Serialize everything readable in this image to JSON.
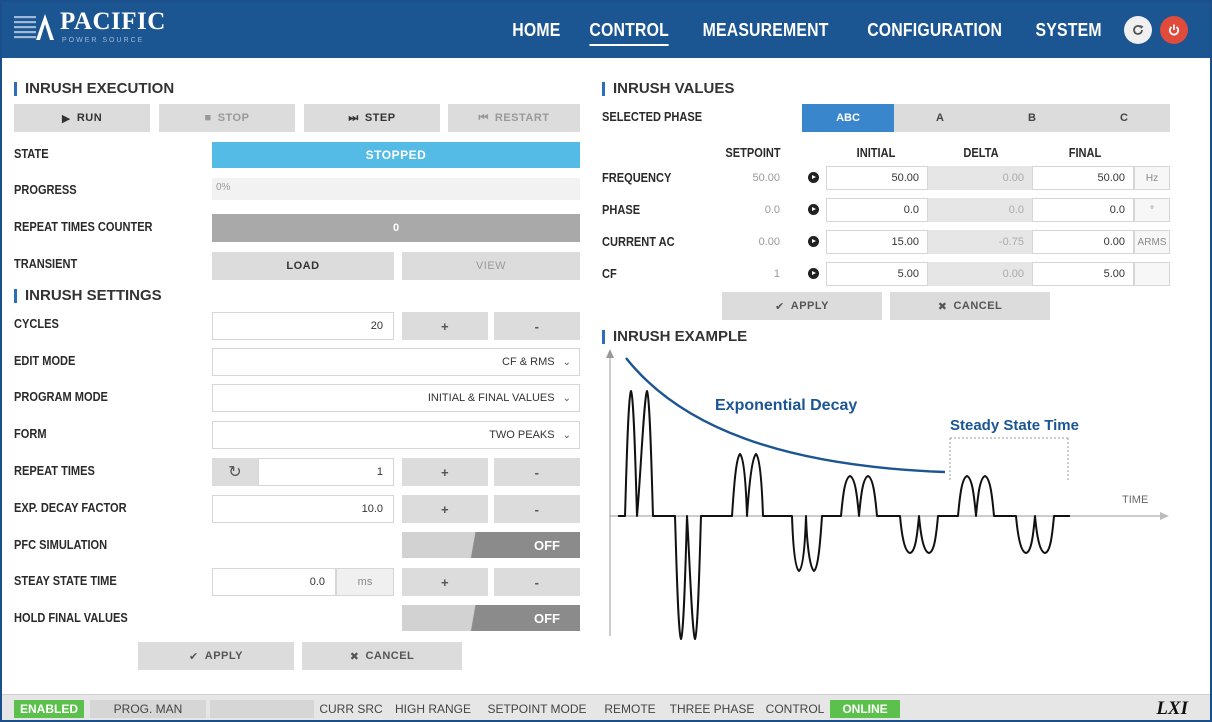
{
  "header": {
    "brand": "PACIFIC",
    "brand_sub": "POWER SOURCE",
    "nav": [
      "HOME",
      "CONTROL",
      "MEASUREMENT",
      "CONFIGURATION",
      "SYSTEM"
    ],
    "active_nav": "CONTROL"
  },
  "execution": {
    "title": "INRUSH EXECUTION",
    "run": "RUN",
    "stop": "STOP",
    "step": "STEP",
    "restart": "RESTART",
    "state_label": "STATE",
    "state_value": "STOPPED",
    "progress_label": "PROGRESS",
    "progress_value": "0%",
    "progress_fraction": 0,
    "repeat_counter_label": "REPEAT TIMES COUNTER",
    "repeat_counter_value": "0",
    "transient_label": "TRANSIENT",
    "load": "LOAD",
    "view": "VIEW"
  },
  "settings": {
    "title": "INRUSH SETTINGS",
    "cycles_label": "CYCLES",
    "cycles_value": "20",
    "edit_mode_label": "EDIT MODE",
    "edit_mode_value": "CF & RMS",
    "program_mode_label": "PROGRAM MODE",
    "program_mode_value": "INITIAL & FINAL VALUES",
    "form_label": "FORM",
    "form_value": "TWO PEAKS",
    "repeat_times_label": "REPEAT TIMES",
    "repeat_times_value": "1",
    "decay_label": "EXP. DECAY FACTOR",
    "decay_value": "10.0",
    "pfc_label": "PFC SIMULATION",
    "pfc_value": "OFF",
    "steady_label": "STEAY STATE TIME",
    "steady_value": "0.0",
    "steady_unit": "ms",
    "hold_label": "HOLD FINAL VALUES",
    "hold_value": "OFF",
    "plus": "+",
    "minus": "-",
    "apply": "APPLY",
    "cancel": "CANCEL"
  },
  "values": {
    "title": "INRUSH VALUES",
    "selected_phase_label": "SELECTED PHASE",
    "phases": [
      "ABC",
      "A",
      "B",
      "C"
    ],
    "active_phase": "ABC",
    "columns": [
      "SETPOINT",
      "INITIAL",
      "DELTA",
      "FINAL"
    ],
    "rows": [
      {
        "label": "FREQUENCY",
        "setpoint": "50.00",
        "initial": "50.00",
        "delta": "0.00",
        "final": "50.00",
        "unit": "Hz"
      },
      {
        "label": "PHASE",
        "setpoint": "0.0",
        "initial": "0.0",
        "delta": "0.0",
        "final": "0.0",
        "unit": "°"
      },
      {
        "label": "CURRENT AC",
        "setpoint": "0.00",
        "initial": "15.00",
        "delta": "-0.75",
        "final": "0.00",
        "unit": "ARMS"
      },
      {
        "label": "CF",
        "setpoint": "1",
        "initial": "5.00",
        "delta": "0.00",
        "final": "5.00",
        "unit": ""
      }
    ],
    "apply": "APPLY",
    "cancel": "CANCEL"
  },
  "example": {
    "title": "INRUSH EXAMPLE",
    "decay_label": "Exponential Decay",
    "steady_label": "Steady State Time",
    "axis_label": "TIME",
    "accent": "#1b5592"
  },
  "footer": {
    "enabled": "ENABLED",
    "prog": "PROG. MAN",
    "curr_src": "CURR SRC",
    "high_range": "HIGH RANGE",
    "setpoint_mode": "SETPOINT MODE",
    "remote": "REMOTE",
    "three_phase": "THREE PHASE",
    "control": "CONTROL",
    "online": "ONLINE",
    "lxi": "LXI"
  }
}
